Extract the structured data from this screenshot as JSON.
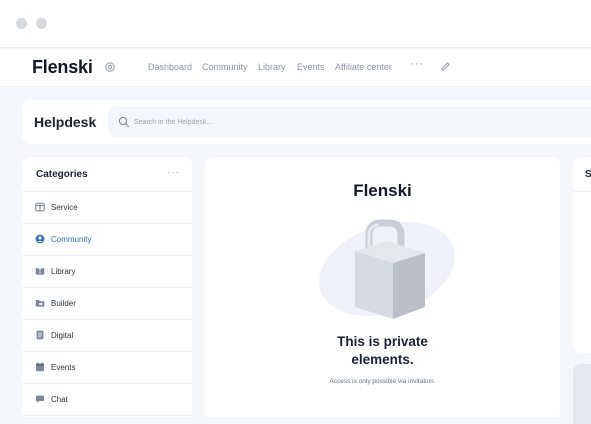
{
  "window": {
    "controls": [
      "close-dot",
      "minimize-dot"
    ]
  },
  "topnav": {
    "brand": "Flenski",
    "items": [
      "Dashboard",
      "Community",
      "Library",
      "Events",
      "Affiliate center"
    ],
    "more": "···"
  },
  "helpdesk": {
    "title": "Helpdesk",
    "search_placeholder": "Search in the Helpdesk..."
  },
  "categories": {
    "title": "Categories",
    "more": "···",
    "items": [
      {
        "label": "Service",
        "icon": "columns-icon",
        "active": false
      },
      {
        "label": "Community",
        "icon": "user-circle-icon",
        "active": true
      },
      {
        "label": "Library",
        "icon": "book-icon",
        "active": false
      },
      {
        "label": "Builder",
        "icon": "folder-icon",
        "active": false
      },
      {
        "label": "Digital",
        "icon": "document-icon",
        "active": false
      },
      {
        "label": "Events",
        "icon": "calendar-icon",
        "active": false
      },
      {
        "label": "Chat",
        "icon": "chat-icon",
        "active": false
      }
    ]
  },
  "main": {
    "logo": "Flenski",
    "title_line1": "This is private",
    "title_line2": "elements.",
    "description": "Access is only possible via invitation."
  },
  "side": {
    "title_initial": "S"
  },
  "colors": {
    "accent": "#2f6fbf",
    "background": "#f3f6fb",
    "card": "#ffffff",
    "muted_text": "#8d95a3"
  }
}
